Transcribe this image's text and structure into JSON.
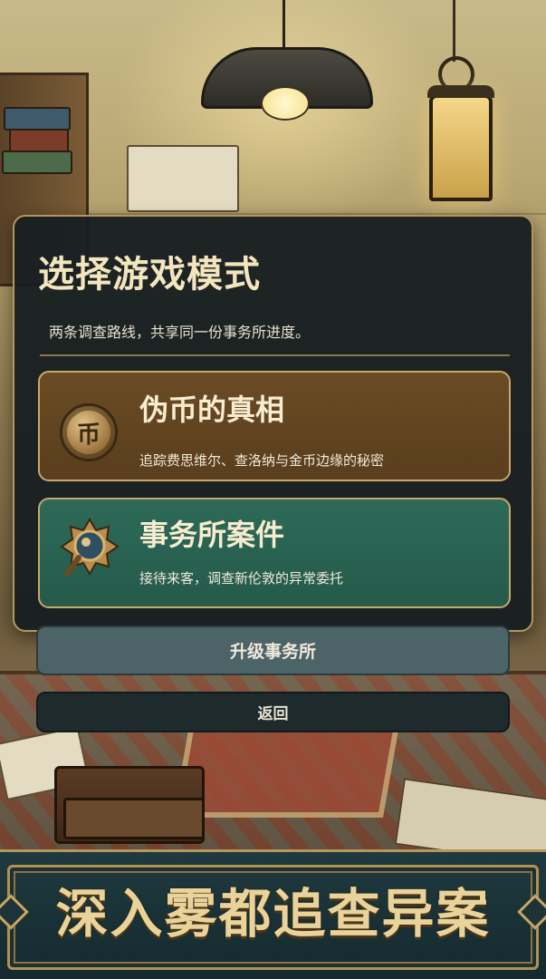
{
  "dialog": {
    "title": "选择游戏模式",
    "subtitle": "两条调查路线，共享同一份事务所进度。"
  },
  "modes": [
    {
      "title": "伪币的真相",
      "description": "追踪费思维尔、查洛纳与金币边缘的秘密",
      "icon": "coin-icon"
    },
    {
      "title": "事务所案件",
      "description": "接待来客，调查新伦敦的异常委托",
      "icon": "magnifier-icon"
    }
  ],
  "buttons": {
    "upgrade": "升级事务所",
    "back": "返回"
  },
  "banner": {
    "text": "深入雾都追查异案"
  },
  "colors": {
    "dialog_bg": "#181f21",
    "gold_border": "#b3975d",
    "card_fake_bg": "#6a4b24",
    "card_office_bg": "#2e6a58",
    "upgrade_bg": "#4c6468",
    "back_bg": "#1f2a2d",
    "banner_bg": "#1f3a3f"
  }
}
